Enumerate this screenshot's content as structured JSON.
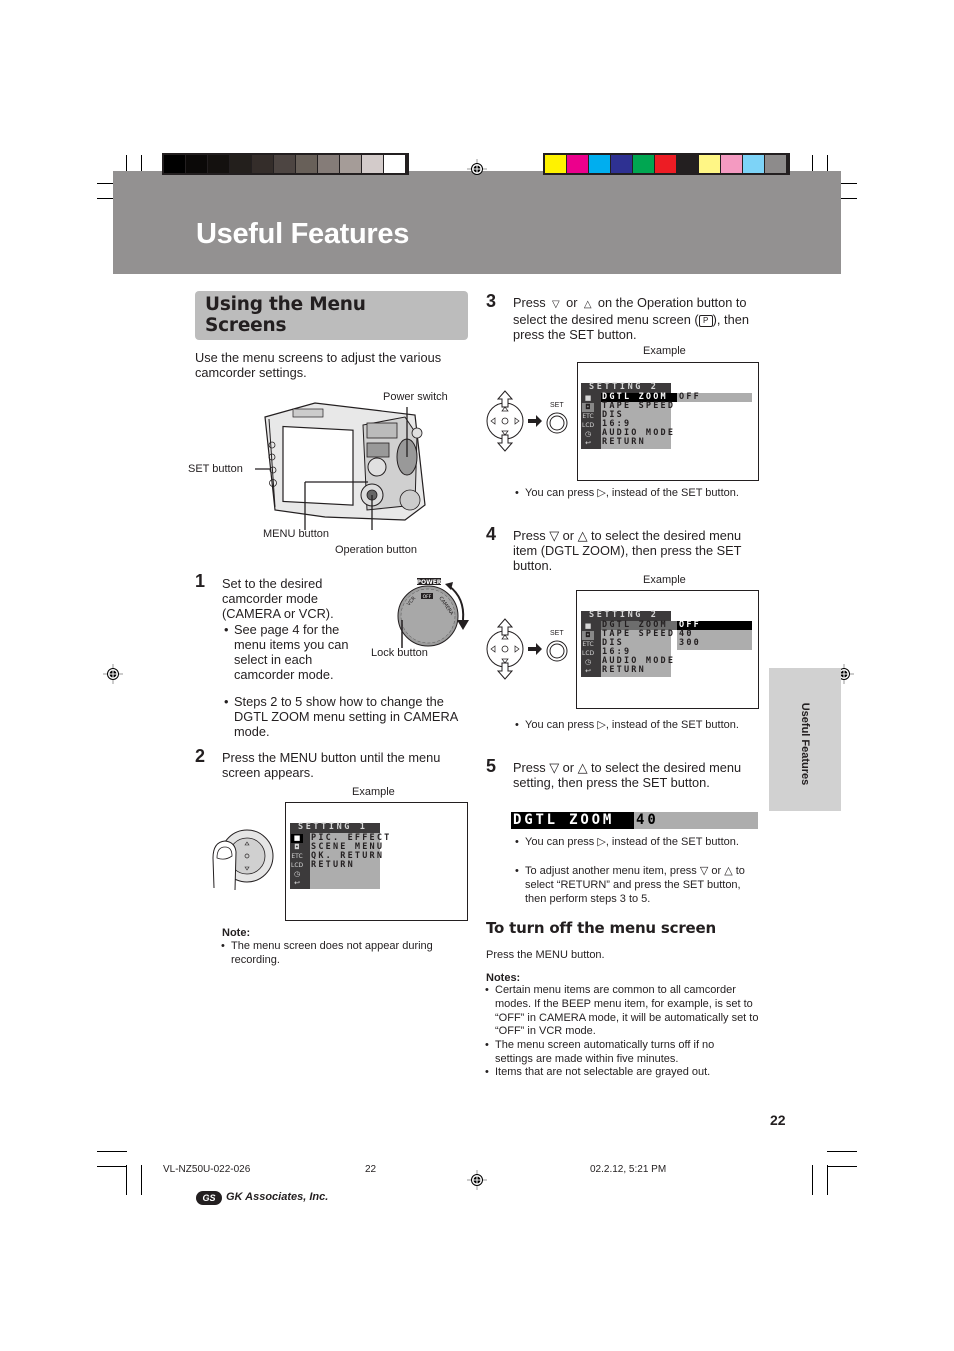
{
  "header": {
    "title": "Useful Features",
    "gray_swatches": [
      "#000000",
      "#0b0908",
      "#14110f",
      "#231f1c",
      "#342d2a",
      "#4d4542",
      "#686059",
      "#857c78",
      "#a59c98",
      "#d3cbca",
      "#ffffff"
    ],
    "color_swatches": [
      "#fff200",
      "#ec008c",
      "#00aeef",
      "#2e3192",
      "#00a651",
      "#ed1c24",
      "#231f20",
      "#fff685",
      "#f49ac1",
      "#7dd3f7",
      "#8d8b8b"
    ],
    "band_color": "#939191"
  },
  "section": {
    "title_line1": "Using the Menu",
    "title_line2": "Screens",
    "intro": "Use the menu screens to adjust the various camcorder settings."
  },
  "camera_figure": {
    "power_switch_label": "Power switch",
    "set_button_label": "SET button",
    "menu_button_label": "MENU button",
    "operation_button_label": "Operation button"
  },
  "step1": {
    "number": "1",
    "text": "Set to the desired camcorder mode (CAMERA or VCR).",
    "bullet1": "See page 4 for the menu items you can select in each camcorder mode.",
    "bullet2": "Steps 2 to 5 show how to change the DGTL ZOOM menu setting in CAMERA mode.",
    "lock_button_label": "Lock button",
    "dial_power": "POWER",
    "dial_vcr": "VCR",
    "dial_off": "OFF",
    "dial_camera": "CAMERA"
  },
  "step2": {
    "number": "2",
    "text": "Press the MENU button until the menu screen appears.",
    "example_label": "Example",
    "menu": {
      "title": "SETTING 1",
      "items": [
        "PIC. EFFECT",
        "SCENE MENU",
        "QK. RETURN",
        "RETURN"
      ]
    },
    "note_heading": "Note:",
    "note": "The menu screen does not appear during recording."
  },
  "step3": {
    "number": "3",
    "text_a": "Press",
    "text_b": "or",
    "text_c": "on the Operation button to select the desired menu screen (",
    "text_d": "), then press the SET button.",
    "example_label": "Example",
    "set_label": "SET",
    "menu": {
      "title": "SETTING 2",
      "items": [
        "DGTL ZOOM",
        "TAPE SPEED",
        "DIS",
        "16:9",
        "AUDIO MODE",
        "RETURN"
      ],
      "selected_value": "OFF"
    },
    "bullet": "You can press ▷, instead of the SET button."
  },
  "step4": {
    "number": "4",
    "text": "Press ▽ or △ to select the desired menu item (DGTL ZOOM), then press the SET button.",
    "example_label": "Example",
    "set_label": "SET",
    "menu": {
      "title": "SETTING 2",
      "items": [
        "DGTL ZOOM",
        "TAPE SPEED",
        "DIS",
        "16:9",
        "AUDIO MODE",
        "RETURN"
      ],
      "options": [
        "OFF",
        "40",
        "300"
      ]
    },
    "bullet": "You can press ▷, instead of the SET button."
  },
  "step5": {
    "number": "5",
    "text": "Press ▽ or △ to select the desired menu setting, then press the SET button.",
    "display_label": "DGTL ZOOM",
    "display_value": "40",
    "bullet1": "You can press ▷, instead of the SET button.",
    "bullet2": "To adjust another menu item, press ▽ or △ to select “RETURN” and press the SET button, then perform steps 3 to 5."
  },
  "turn_off": {
    "heading": "To turn off the menu screen",
    "text": "Press the MENU button.",
    "notes_heading": "Notes:",
    "notes": [
      "Certain menu items are common to all camcorder modes. If the BEEP menu item, for example, is set to “OFF” in CAMERA mode, it will be automatically set to “OFF” in VCR mode.",
      "The menu screen automatically turns off if no settings are made within five minutes.",
      "Items that are not selectable are grayed out."
    ]
  },
  "side_tab": {
    "label": "Useful Features"
  },
  "page_number": "22",
  "footer": {
    "doc_id": "VL-NZ50U-022-026",
    "page": "22",
    "timestamp": "02.2.12, 5:21 PM",
    "company": "GK Associates, Inc."
  }
}
